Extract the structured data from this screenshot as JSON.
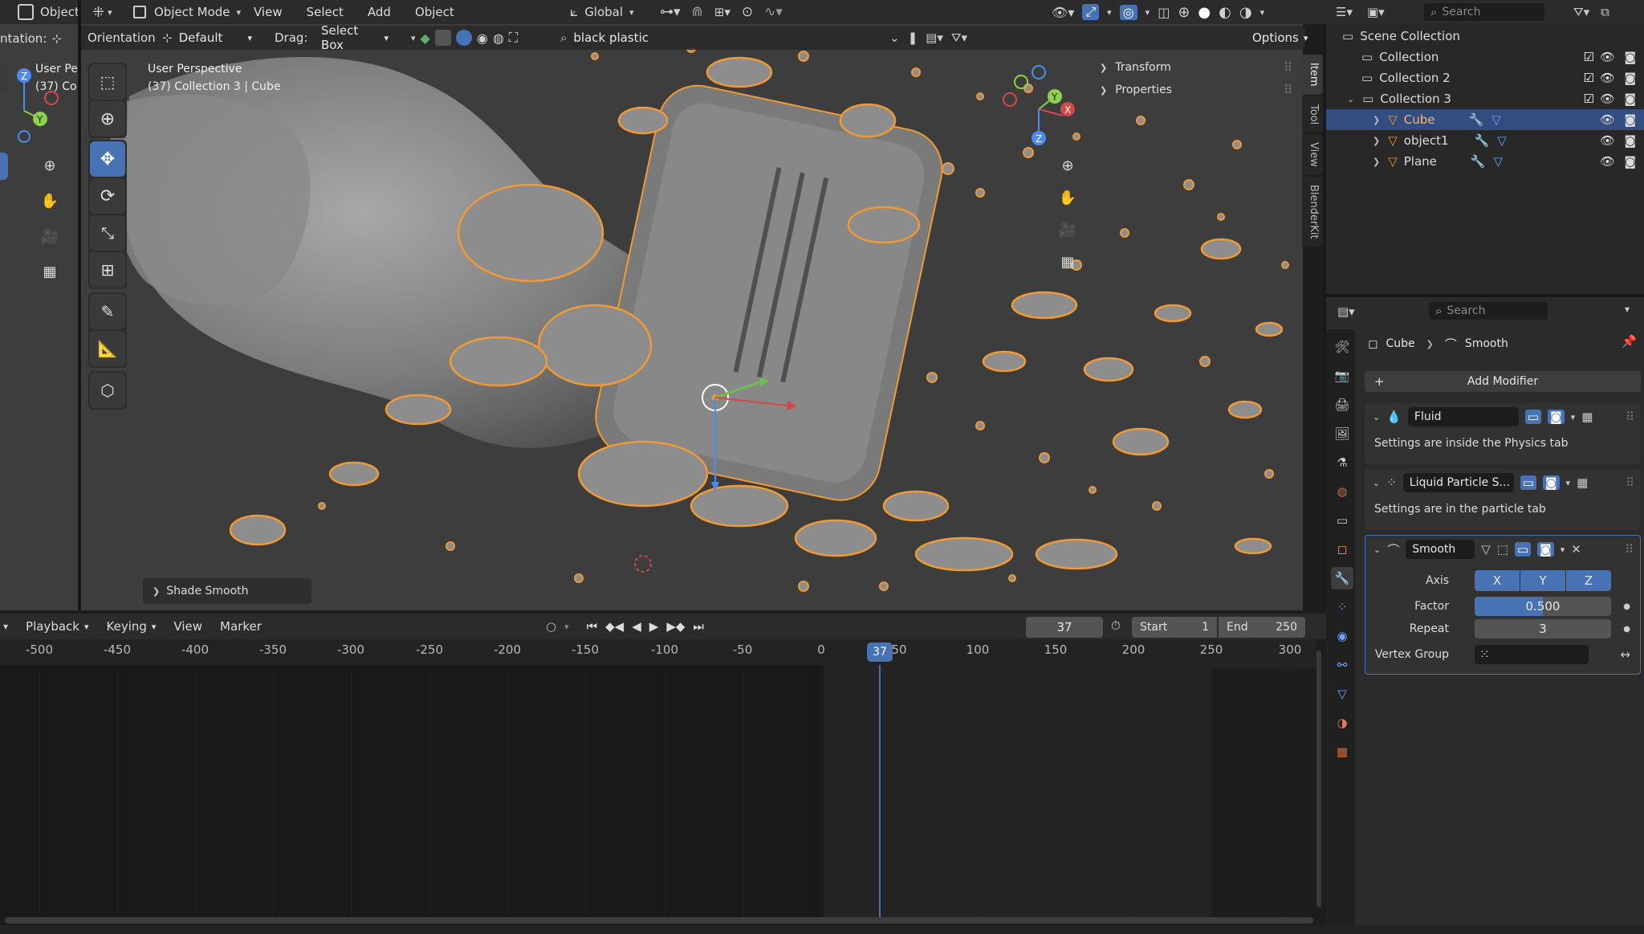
{
  "topbar": {
    "left_editor_label": "Object",
    "object_mode": "Object Mode",
    "menu": [
      "View",
      "Select",
      "Add",
      "Object"
    ],
    "transform_orientation": "Global"
  },
  "left_strip": {
    "orientation_label": "ntation:",
    "user_label": "User Pe",
    "collection_label": "(37) Co"
  },
  "viewport_header": {
    "orientation_label": "Orientation:",
    "orientation_value": "Default",
    "drag_label": "Drag:",
    "drag_value": "Select Box",
    "material_search": "black plastic",
    "options_label": "Options"
  },
  "viewport": {
    "perspective_label": "User Perspective",
    "context_label": "(37) Collection 3 | Cube",
    "last_op": "Shade Smooth",
    "npanel_sections": [
      "Transform",
      "Properties"
    ],
    "npanel_tabs": [
      "Item",
      "Tool",
      "View",
      "BlenderKit"
    ]
  },
  "outliner": {
    "search_placeholder": "Search",
    "scene_collection": "Scene Collection",
    "items": [
      {
        "label": "Collection"
      },
      {
        "label": "Collection 2"
      },
      {
        "label": "Collection 3"
      },
      {
        "label": "Cube"
      },
      {
        "label": "object1"
      },
      {
        "label": "Plane"
      }
    ]
  },
  "properties": {
    "search_placeholder": "Search",
    "breadcrumb_object": "Cube",
    "breadcrumb_modifier": "Smooth",
    "add_modifier": "Add Modifier",
    "modifiers": [
      {
        "name": "Fluid",
        "note": "Settings are inside the Physics tab"
      },
      {
        "name": "Liquid Particle S...",
        "note": "Settings are in the particle tab"
      },
      {
        "name": "Smooth"
      }
    ],
    "smooth": {
      "axis_label": "Axis",
      "axis_x": "X",
      "axis_y": "Y",
      "axis_z": "Z",
      "factor_label": "Factor",
      "factor_value": "0.500",
      "factor_fraction": 0.5,
      "repeat_label": "Repeat",
      "repeat_value": "3",
      "vertex_group_label": "Vertex Group"
    }
  },
  "timeline": {
    "menu": [
      "Playback",
      "Keying",
      "View",
      "Marker"
    ],
    "current_frame": "37",
    "start_label": "Start",
    "start_value": "1",
    "end_label": "End",
    "end_value": "250",
    "ticks": [
      "-500",
      "-450",
      "-400",
      "-350",
      "-300",
      "-250",
      "-200",
      "-150",
      "-100",
      "-50",
      "0",
      "50",
      "100",
      "150",
      "200",
      "250",
      "300"
    ],
    "playhead": "37"
  },
  "colors": {
    "accent_blue": "#4772b3",
    "selection_orange": "#f19a34",
    "bg_dark": "#1d1d1d",
    "viewport_bg": "#3d3d3d"
  }
}
